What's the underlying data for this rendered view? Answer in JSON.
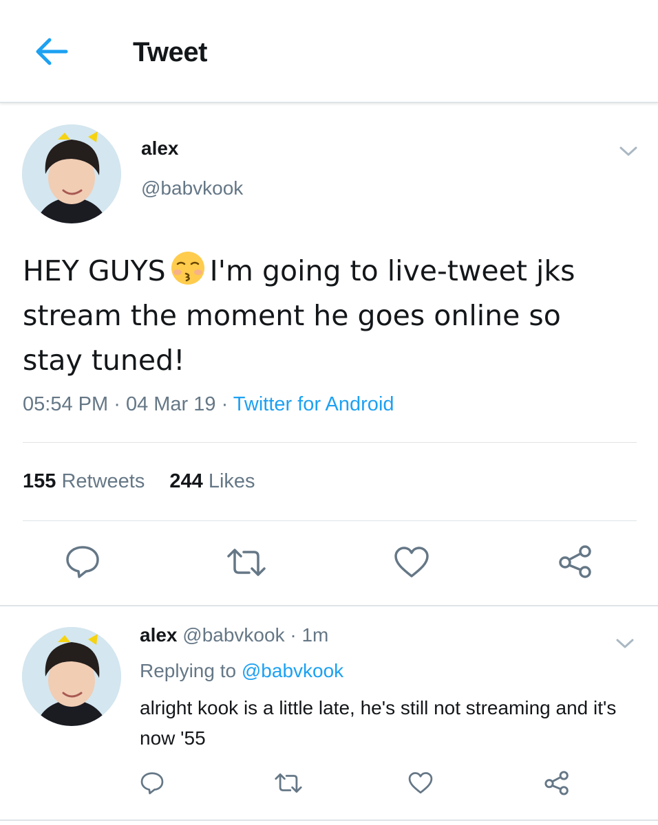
{
  "header": {
    "title": "Tweet",
    "back_icon": "arrow-left-icon"
  },
  "tweet": {
    "name": "alex",
    "handle": "@babvkook",
    "text_before_emoji": "HEY GUYS",
    "emoji": "kissing-face-with-closed-eyes-emoji",
    "text_after_emoji": "I'm going to live-tweet jks stream the moment he goes online so stay tuned!",
    "time": "05:54 PM",
    "date": "04 Mar 19",
    "source": "Twitter for Android",
    "separator": "·",
    "retweets_count": "155",
    "retweets_label": "Retweets",
    "likes_count": "244",
    "likes_label": "Likes"
  },
  "reply": {
    "name": "alex",
    "handle": "@babvkook",
    "separator": "·",
    "time_ago": "1m",
    "replying_label": "Replying to",
    "replying_to": "@babvkook",
    "text": "alright kook is a little late, he's still not streaming and it's now '55"
  },
  "colors": {
    "accent": "#1da1f2",
    "secondary_text": "#657786",
    "primary_text": "#14171a",
    "divider": "#dfe3e6"
  }
}
